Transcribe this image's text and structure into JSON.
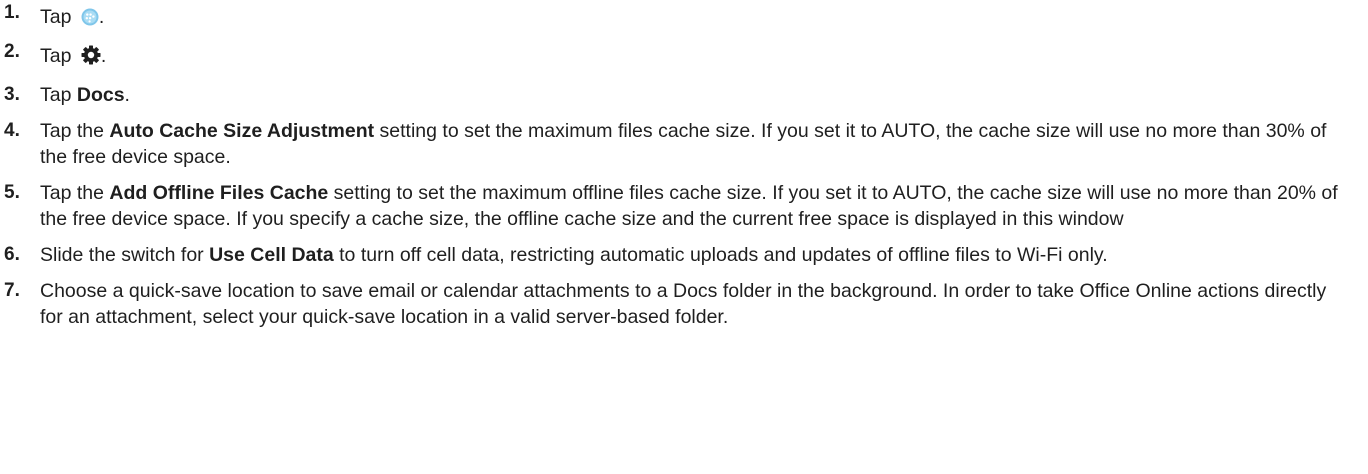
{
  "steps": [
    {
      "num": "1.",
      "pre": "Tap",
      "icon": "bbm-app-icon",
      "post": "."
    },
    {
      "num": "2.",
      "pre": "Tap",
      "icon": "gear-icon",
      "post": "."
    },
    {
      "num": "3.",
      "pre": "Tap ",
      "bold": "Docs",
      "post": "."
    },
    {
      "num": "4.",
      "pre": "Tap the ",
      "bold": "Auto Cache Size Adjustment",
      "post": " setting to set the maximum files cache size. If you set it to AUTO, the cache size will use no more than 30% of the free device space."
    },
    {
      "num": "5.",
      "pre": "Tap the ",
      "bold": "Add Offline Files Cache",
      "post": " setting to set the maximum offline files cache size. If you set it to AUTO, the cache size will use no more than 20% of the free device space. If you specify a cache size, the offline cache size and the current free space is displayed in this window"
    },
    {
      "num": "6.",
      "pre": "Slide the switch for ",
      "bold": "Use Cell Data",
      "post": " to turn off cell data, restricting automatic uploads and updates of offline files to Wi-Fi only."
    },
    {
      "num": "7.",
      "pre": "Choose a quick-save location to save email or calendar attachments to a Docs folder in the background. In order to take Office Online actions directly for an attachment, select your quick-save location in a valid server-based folder."
    }
  ],
  "colors": {
    "text": "#1f1f1f",
    "app_icon": "#7fc6ea",
    "gear_icon": "#1f1f1f"
  }
}
